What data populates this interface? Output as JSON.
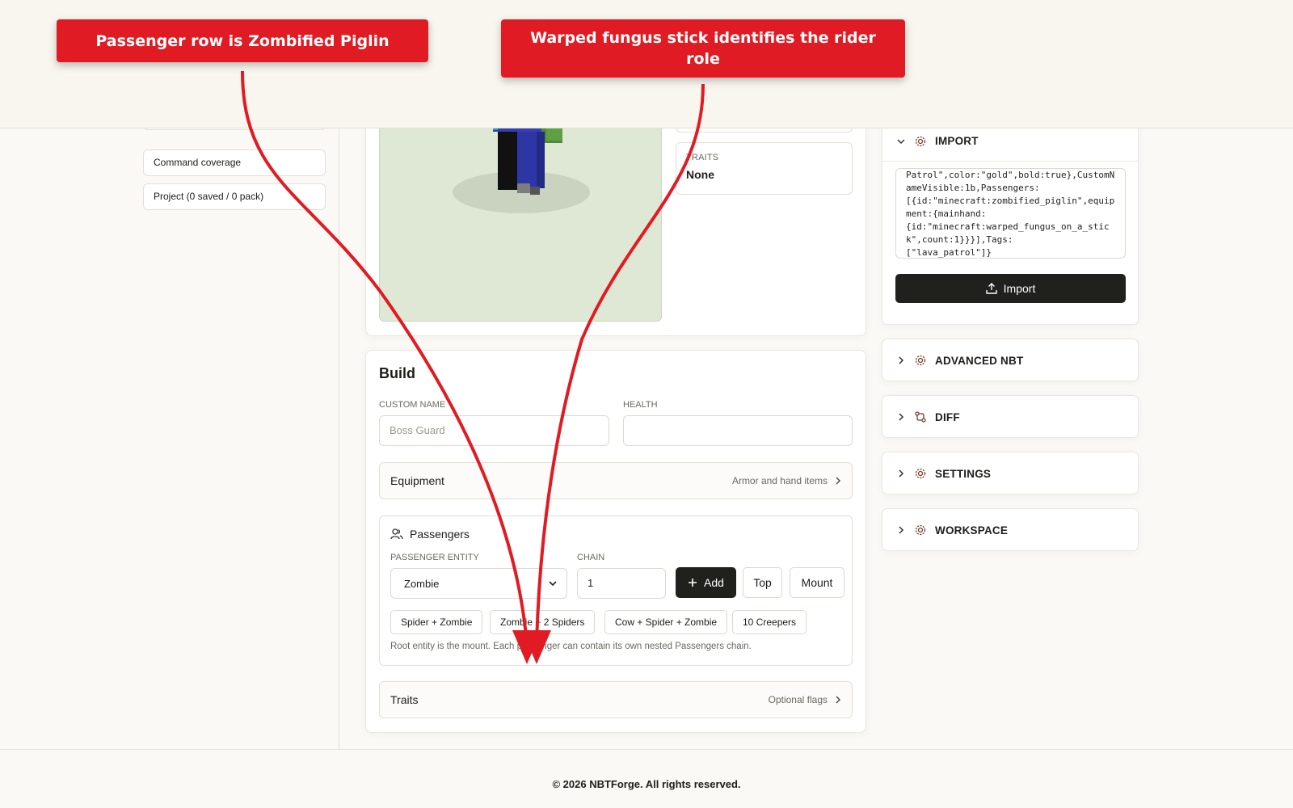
{
  "sidebar": {
    "items": [
      {
        "label": "Command coverage"
      },
      {
        "label": "Project (0 saved / 0 pack)"
      }
    ]
  },
  "preview": {
    "traits_label": "TRAITS",
    "traits_value": "None"
  },
  "build": {
    "title": "Build",
    "custom_name_label": "CUSTOM NAME",
    "custom_name_placeholder": "Boss Guard",
    "health_label": "HEALTH",
    "health_value": "",
    "equipment": {
      "title": "Equipment",
      "meta": "Armor and hand items"
    },
    "passengers": {
      "title": "Passengers",
      "entity_label": "PASSENGER ENTITY",
      "entity_value": "Zombie",
      "chain_label": "CHAIN",
      "chain_value": "1",
      "add_label": "Add",
      "top_label": "Top",
      "mount_label": "Mount",
      "presets": [
        "Spider + Zombie",
        "Zombie + 2 Spiders",
        "Cow + Spider + Zombie",
        "10 Creepers"
      ],
      "note": "Root entity is the mount. Each passenger can contain its own nested Passengers chain."
    },
    "traits": {
      "title": "Traits",
      "meta": "Optional flags"
    }
  },
  "right_panel": {
    "import": {
      "title": "IMPORT",
      "text": "Patrol\",color:\"gold\",bold:true},CustomNameVisible:1b,Passengers:\n[{id:\"minecraft:zombified_piglin\",equipment:{mainhand:\n{id:\"minecraft:warped_fungus_on_a_stick\",count:1}}}],Tags:\n[\"lava_patrol\"]}",
      "button_label": "Import"
    },
    "sections": [
      {
        "title": "ADVANCED NBT",
        "icon": "gear-icon"
      },
      {
        "title": "DIFF",
        "icon": "git-compare-icon"
      },
      {
        "title": "SETTINGS",
        "icon": "gear-icon"
      },
      {
        "title": "WORKSPACE",
        "icon": "gear-icon"
      }
    ]
  },
  "footer": {
    "text": "© 2026 NBTForge. All rights reserved."
  },
  "annotations": [
    {
      "text": "Passenger row is Zombified Piglin"
    },
    {
      "text": "Warped fungus stick identifies the rider role"
    }
  ],
  "colors": {
    "accent_dark": "#20211d",
    "callout_red": "#e01b24",
    "preview_bg": "#dfe8d5",
    "page_bg": "#fbf9f6"
  }
}
